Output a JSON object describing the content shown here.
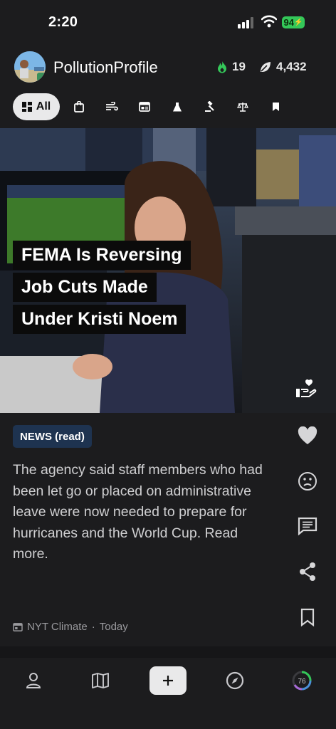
{
  "status_bar": {
    "time": "2:20",
    "battery": "94"
  },
  "header": {
    "brand": "PollutionProfile",
    "streak": "19",
    "points": "4,432",
    "streak_icon": "flame-icon",
    "points_icon": "leaf-icon"
  },
  "filters": {
    "active_label": "All",
    "icons": [
      "shopping-bag-icon",
      "wind-icon",
      "newspaper-icon",
      "flask-icon",
      "gavel-icon",
      "scales-icon",
      "bookmark-icon"
    ]
  },
  "article": {
    "headline_lines": [
      "FEMA Is Reversing",
      "Job Cuts Made",
      "Under Kristi Noem"
    ],
    "badge": "NEWS (read)",
    "summary": "The agency said staff members who had been let go or placed on administrative leave were now needed to prepare for hurricanes and the World Cup. Read more.",
    "source": "NYT Climate",
    "date": "Today",
    "separator": "·"
  },
  "actions": [
    "heart-icon",
    "emoji-icon",
    "comment-icon",
    "share-icon",
    "bookmark-icon"
  ],
  "bottom_nav": {
    "items": [
      "profile-icon",
      "map-icon",
      "plus-icon",
      "compass-icon",
      "score-ring-icon"
    ],
    "score": "76"
  },
  "colors": {
    "accent_green": "#34c759",
    "badge_bg": "#1e3350",
    "chip_bg": "#e9e9ea"
  }
}
